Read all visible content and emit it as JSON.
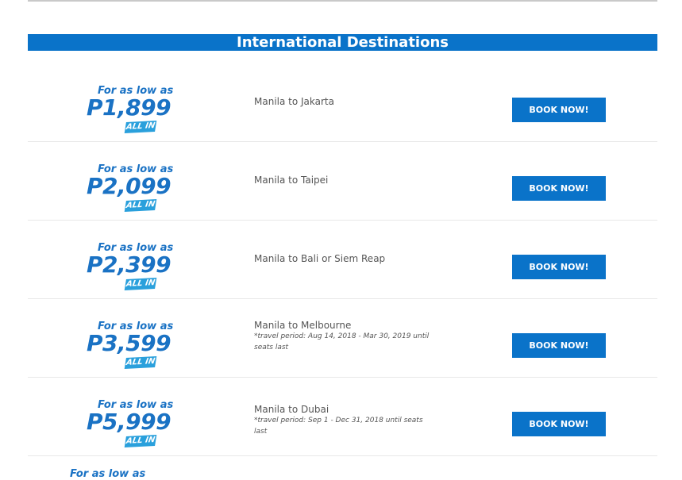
{
  "section": {
    "title": "International Destinations"
  },
  "deals": [
    {
      "low_label": "For as low as",
      "price": "P1,899",
      "badge": "ALL IN",
      "route": "Manila to Jakarta",
      "note": "",
      "button": "BOOK NOW!"
    },
    {
      "low_label": "For as low as",
      "price": "P2,099",
      "badge": "ALL IN",
      "route": "Manila to Taipei",
      "note": "",
      "button": "BOOK NOW!"
    },
    {
      "low_label": "For as low as",
      "price": "P2,399",
      "badge": "ALL IN",
      "route": "Manila to Bali or Siem Reap",
      "note": "",
      "button": "BOOK NOW!"
    },
    {
      "low_label": "For as low as",
      "price": "P3,599",
      "badge": "ALL IN",
      "route": "Manila to Melbourne",
      "note": "*travel period: Aug 14, 2018 - Mar 30, 2019 until seats last",
      "button": "BOOK NOW!"
    },
    {
      "low_label": "For as low as",
      "price": "P5,999",
      "badge": "ALL IN",
      "route": "Manila to Dubai",
      "note": "*travel period: Sep 1 - Dec 31, 2018 until seats last",
      "button": "BOOK NOW!"
    }
  ],
  "next_partial": {
    "low_label": "For as low as"
  },
  "colors": {
    "brand_blue": "#0a73c9",
    "price_blue": "#1a72c4",
    "badge_blue": "#2aa0dc"
  }
}
